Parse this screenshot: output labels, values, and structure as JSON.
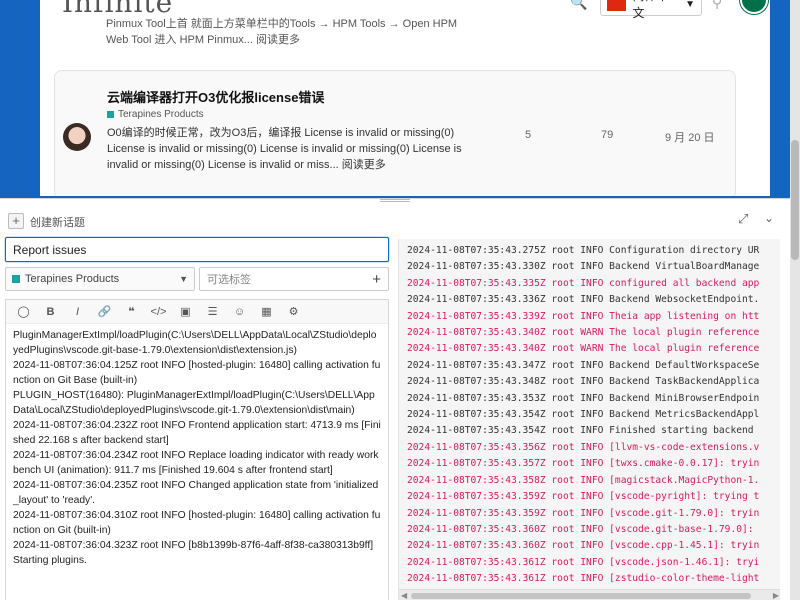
{
  "forum": {
    "logo_text": "Infinite",
    "language": "简体中文",
    "previous_snippet": "Pinmux Tool上首 就面上方菜单栏中的Tools → HPM Tools → Open HPM Web Tool 进入 HPM Pinmux... 阅读更多",
    "topic": {
      "title": "云端编译器打开O3优化报license错误",
      "category": "Terapines Products",
      "excerpt": "O0编译的时候正常，改为O3后，编译报 License is invalid or missing(0) License is invalid or missing(0) License is invalid or missing(0) License is invalid or missing(0) License is invalid or miss... 阅读更多",
      "replies": "5",
      "views": "79",
      "date": "9 月 20 日"
    }
  },
  "composer": {
    "action_label": "创建新话题",
    "title_value": "Report issues",
    "category": "Terapines Products",
    "tags_placeholder": "可选标签",
    "toolbar": [
      "quote-icon",
      "bold-icon",
      "italic-icon",
      "link-icon",
      "blockquote-icon",
      "code-icon",
      "image-icon",
      "list-icon",
      "emoji-icon",
      "date-icon",
      "gear-icon"
    ],
    "body_text": "PluginManagerExtImpl/loadPlugin(C:\\Users\\DELL\\AppData\\Local\\ZStudio\\deployedPlugins\\vscode.git-base-1.79.0\\extension\\dist\\extension.js)\n2024-11-08T07:36:04.125Z root INFO [hosted-plugin: 16480] calling activation function on Git Base (built-in)\nPLUGIN_HOST(16480): PluginManagerExtImpl/loadPlugin(C:\\Users\\DELL\\AppData\\Local\\ZStudio\\deployedPlugins\\vscode.git-1.79.0\\extension\\dist\\main)\n2024-11-08T07:36:04.232Z root INFO Frontend application start: 4713.9 ms [Finished 22.168 s after backend start]\n2024-11-08T07:36:04.234Z root INFO Replace loading indicator with ready workbench UI (animation): 911.7 ms [Finished 19.604 s after frontend start]\n2024-11-08T07:36:04.235Z root INFO Changed application state from 'initialized_layout' to 'ready'.\n2024-11-08T07:36:04.310Z root INFO [hosted-plugin: 16480] calling activation function on Git (built-in)\n2024-11-08T07:36:04.323Z root INFO [b8b1399b-87f6-4aff-8f38-ca380313b9ff] Starting plugins."
  },
  "preview_log": [
    {
      "text": "2024-11-08T07:35:43.275Z root INFO Configuration directory UR",
      "level": "info"
    },
    {
      "text": "2024-11-08T07:35:43.330Z root INFO Backend VirtualBoardManage",
      "level": "info"
    },
    {
      "text": "2024-11-08T07:35:43.335Z root INFO configured all backend app",
      "level": "warn"
    },
    {
      "text": "2024-11-08T07:35:43.336Z root INFO Backend WebsocketEndpoint.",
      "level": "info"
    },
    {
      "text": "2024-11-08T07:35:43.339Z root INFO Theia app listening on htt",
      "level": "warn"
    },
    {
      "text": "2024-11-08T07:35:43.340Z root WARN The local plugin reference",
      "level": "warn"
    },
    {
      "text": "2024-11-08T07:35:43.340Z root WARN The local plugin reference",
      "level": "warn"
    },
    {
      "text": "2024-11-08T07:35:43.347Z root INFO Backend DefaultWorkspaceSe",
      "level": "info"
    },
    {
      "text": "2024-11-08T07:35:43.348Z root INFO Backend TaskBackendApplica",
      "level": "info"
    },
    {
      "text": "2024-11-08T07:35:43.353Z root INFO Backend MiniBrowserEndpoin",
      "level": "info"
    },
    {
      "text": "2024-11-08T07:35:43.354Z root INFO Backend MetricsBackendAppl",
      "level": "info"
    },
    {
      "text": "2024-11-08T07:35:43.354Z root INFO Finished starting backend",
      "level": "info"
    },
    {
      "text": "2024-11-08T07:35:43.356Z root INFO [llvm-vs-code-extensions.v",
      "level": "warn"
    },
    {
      "text": "2024-11-08T07:35:43.357Z root INFO [twxs.cmake-0.0.17]: tryin",
      "level": "warn"
    },
    {
      "text": "2024-11-08T07:35:43.358Z root INFO [magicstack.MagicPython-1.",
      "level": "warn"
    },
    {
      "text": "2024-11-08T07:35:43.359Z root INFO [vscode-pyright]: trying t",
      "level": "warn"
    },
    {
      "text": "2024-11-08T07:35:43.359Z root INFO [vscode.git-1.79.0]: tryin",
      "level": "warn"
    },
    {
      "text": "2024-11-08T07:35:43.360Z root INFO [vscode.git-base-1.79.0]:",
      "level": "warn"
    },
    {
      "text": "2024-11-08T07:35:43.360Z root INFO [vscode.cpp-1.45.1]: tryin",
      "level": "warn"
    },
    {
      "text": "2024-11-08T07:35:43.361Z root INFO [vscode.json-1.46.1]: tryi",
      "level": "warn"
    },
    {
      "text": "2024-11-08T07:35:43.361Z root INFO [zstudio-color-theme-light",
      "level": "warn"
    }
  ],
  "colors": {
    "brand_blue": "#1565c0",
    "category": "#1aa3a3",
    "log_warn": "#d81b60",
    "input_focus": "#0a6cc4"
  }
}
